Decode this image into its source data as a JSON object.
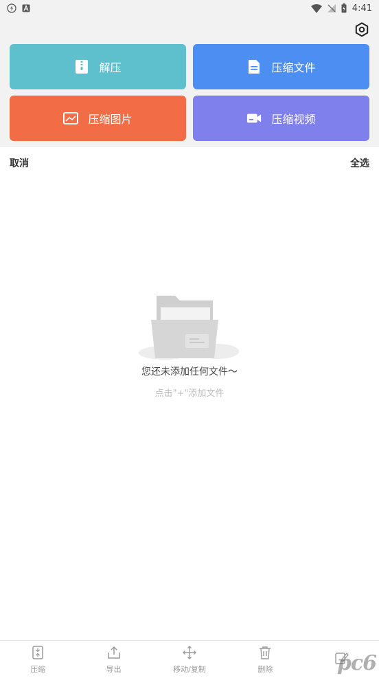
{
  "status_bar": {
    "time": "4:41"
  },
  "tiles": {
    "extract": {
      "label": "解压",
      "icon": "zip-file-icon"
    },
    "compress_files": {
      "label": "压缩文件",
      "icon": "document-icon"
    },
    "compress_images": {
      "label": "压缩图片",
      "icon": "image-icon"
    },
    "compress_video": {
      "label": "压缩视频",
      "icon": "video-camera-icon"
    }
  },
  "actions": {
    "cancel": "取消",
    "select_all": "全选"
  },
  "empty_state": {
    "title": "您还未添加任何文件～",
    "hint": "点击\"+\"添加文件"
  },
  "bottom_nav": [
    {
      "label": "压缩",
      "icon": "compress-icon"
    },
    {
      "label": "导出",
      "icon": "export-icon"
    },
    {
      "label": "移动/复制",
      "icon": "move-icon"
    },
    {
      "label": "删除",
      "icon": "trash-icon"
    },
    {
      "label": "",
      "icon": "rename-icon"
    }
  ],
  "watermark": "pc6",
  "colors": {
    "extract": "#5ec0cc",
    "compress_files": "#4d8ef2",
    "compress_images": "#f26c45",
    "compress_video": "#8080ec"
  }
}
